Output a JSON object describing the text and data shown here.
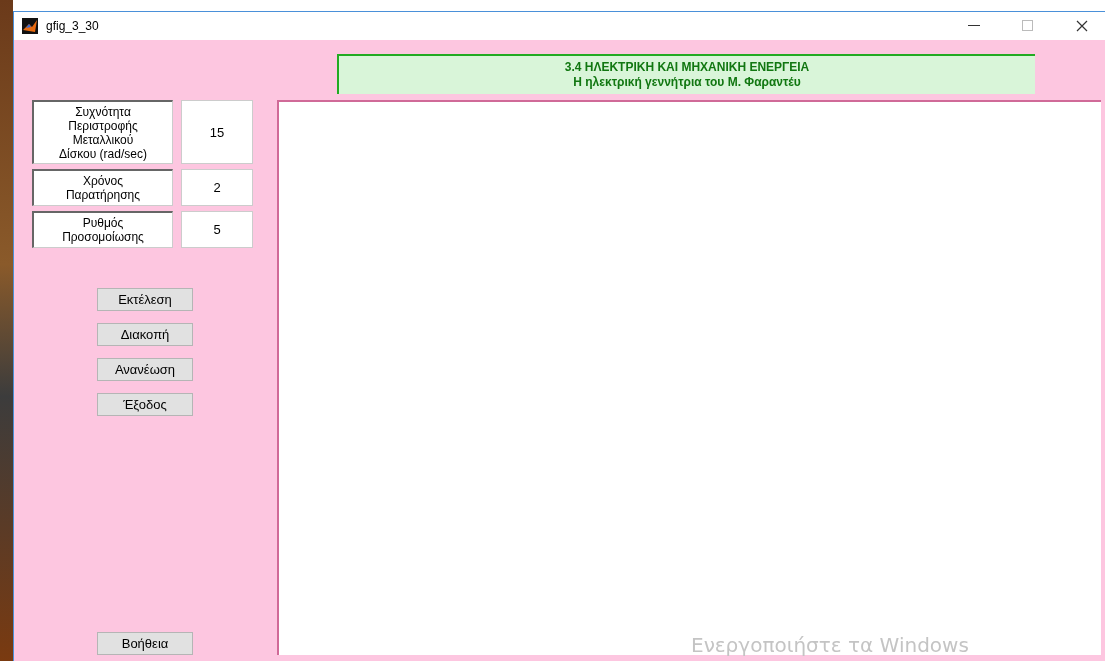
{
  "window": {
    "title": "gfig_3_30"
  },
  "header": {
    "title": "3.4 ΗΛΕΚΤΡΙΚΗ ΚΑΙ ΜΗΧΑΝΙΚΗ ΕΝΕΡΓΕΙΑ",
    "subtitle": "Η ηλεκτρική γεννήτρια του Μ. Φαραντέυ"
  },
  "parameters": [
    {
      "label": "Συχνότητα Περιστροφής Μεταλλικού Δίσκου (rad/sec)",
      "value": "15"
    },
    {
      "label": "Χρόνος Παρατήρησης",
      "value": "2"
    },
    {
      "label": "Ρυθμός Προσομοίωσης",
      "value": "5"
    }
  ],
  "buttons": [
    "Εκτέλεση",
    "Διακοπή",
    "Ανανέωση",
    "Έξοδος"
  ],
  "help_button": "Βοήθεια",
  "activation_notice": "Ενεργοποιήστε τα Windows"
}
